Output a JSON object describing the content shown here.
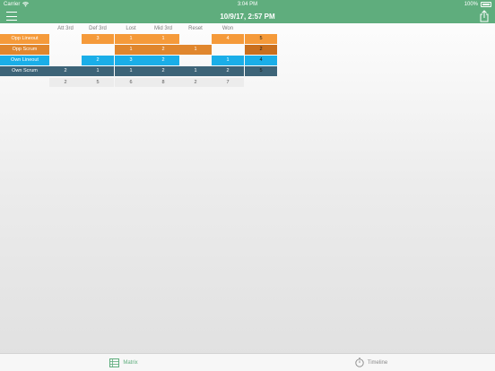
{
  "status": {
    "carrier": "Carrier",
    "time": "3:04 PM",
    "battery": "100%"
  },
  "nav": {
    "title": "10/9/17, 2:57 PM"
  },
  "columns": [
    "Att 3rd",
    "Def 3rd",
    "Lost",
    "Mid 3rd",
    "Reset",
    "Won"
  ],
  "rows": [
    {
      "label": "Opp Lineout",
      "color": "#f59a3a",
      "cells": [
        "",
        "3",
        "1",
        "1",
        "",
        "4"
      ],
      "total": "5",
      "total_color": "#f59a3a"
    },
    {
      "label": "Opp Scrum",
      "color": "#e0862d",
      "cells": [
        "",
        "",
        "1",
        "2",
        "1",
        ""
      ],
      "total": "2",
      "total_color": "#c96f1e"
    },
    {
      "label": "Own Lineout",
      "color": "#1aaee8",
      "cells": [
        "",
        "2",
        "3",
        "2",
        "",
        "1"
      ],
      "total": "4",
      "total_color": "#1aaee8"
    },
    {
      "label": "Own Scrum",
      "color": "#3d6478",
      "cells": [
        "2",
        "1",
        "1",
        "2",
        "1",
        "2"
      ],
      "total": "5",
      "total_color": "#3d6478"
    }
  ],
  "totals": [
    "2",
    "5",
    "6",
    "8",
    "2",
    "7"
  ],
  "tabs": [
    {
      "label": "Matrix",
      "icon": "matrix-icon",
      "active": true
    },
    {
      "label": "Timeline",
      "icon": "stopwatch-icon",
      "active": false
    }
  ]
}
